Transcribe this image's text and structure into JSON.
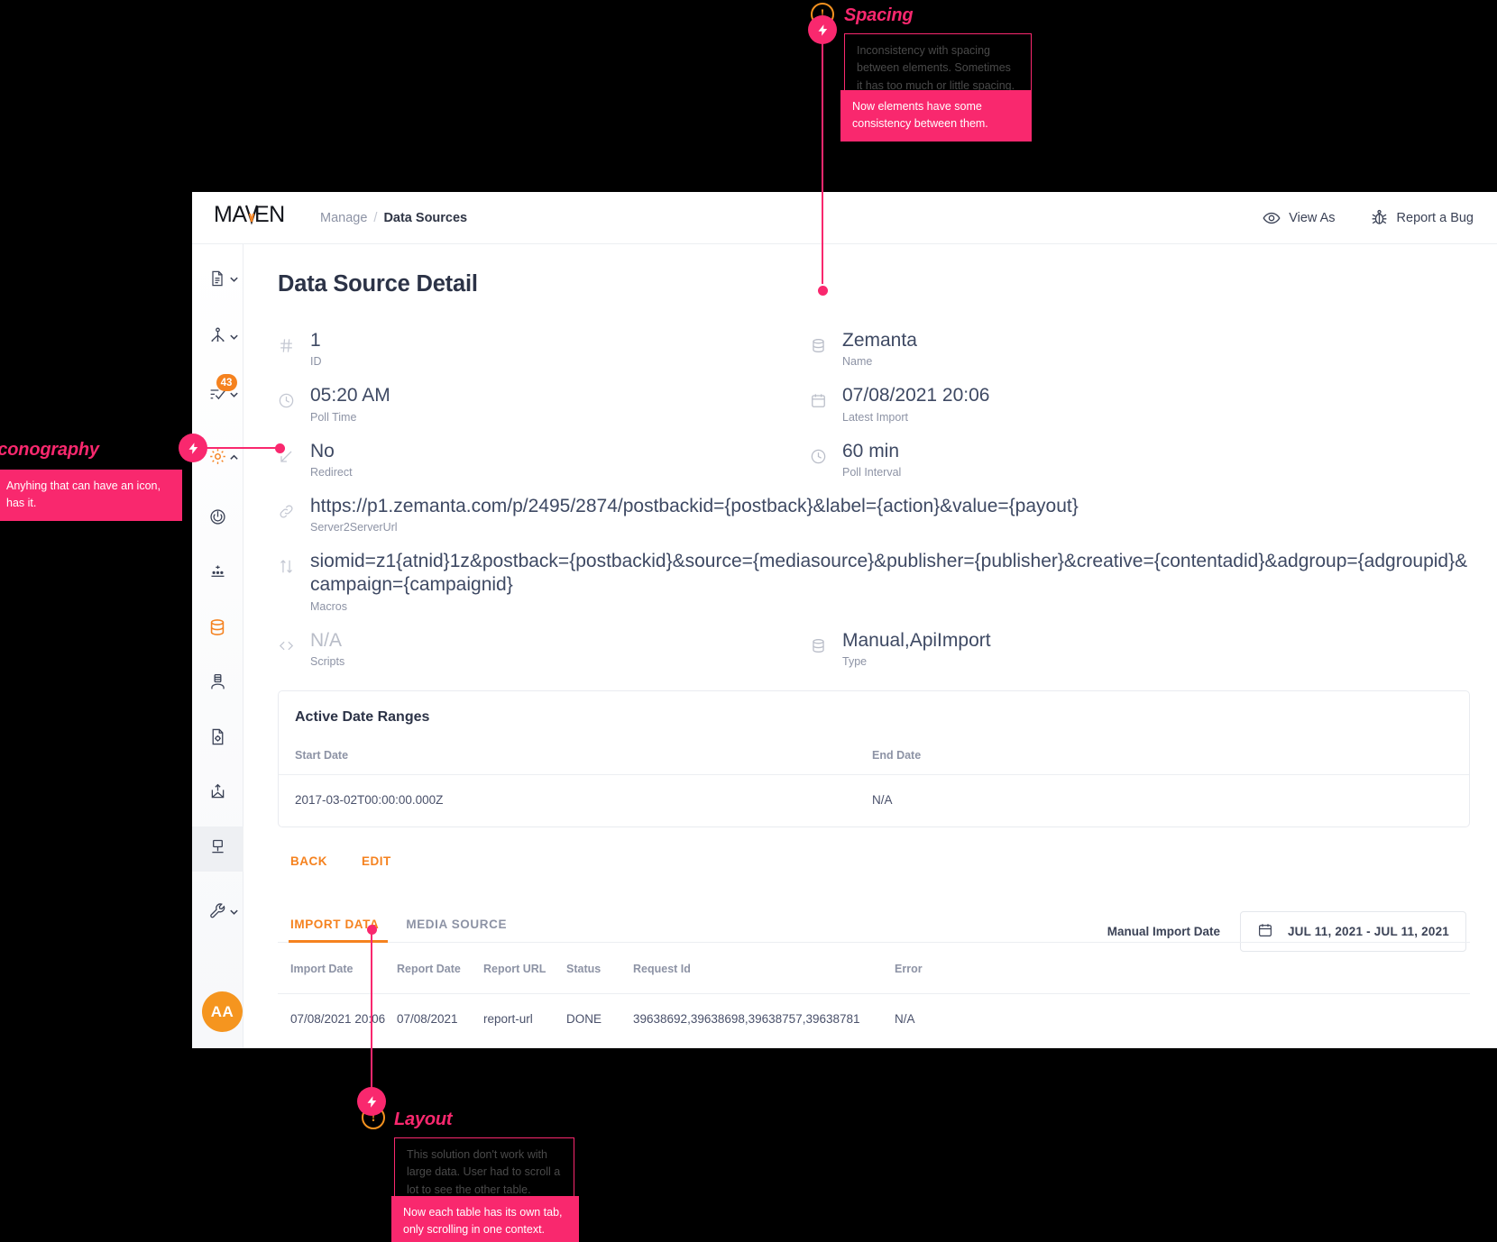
{
  "app": {
    "logo": "MAVEN",
    "breadcrumb": {
      "parent": "Manage",
      "separator": "/",
      "current": "Data Sources"
    },
    "header_actions": [
      {
        "id": "view-as",
        "label": "View As",
        "icon": "eye-icon"
      },
      {
        "id": "report-a-bug",
        "label": "Report a Bug",
        "icon": "bug-icon"
      }
    ]
  },
  "sidebar": {
    "items": [
      {
        "id": "documents",
        "icon": "document-icon",
        "chevron": "down",
        "badge": null
      },
      {
        "id": "network",
        "icon": "network-share-icon",
        "chevron": "down",
        "badge": null
      },
      {
        "id": "tasks",
        "icon": "checklist-icon",
        "chevron": "down",
        "badge": "43"
      },
      {
        "id": "settings",
        "icon": "gear-icon",
        "chevron": "up",
        "badge": null,
        "active": true
      },
      {
        "id": "power",
        "icon": "power-target-icon",
        "chevron": null,
        "badge": null
      },
      {
        "id": "analytics",
        "icon": "scatter-plot-icon",
        "chevron": null,
        "badge": null
      },
      {
        "id": "data-sources",
        "icon": "database-icon",
        "chevron": null,
        "badge": null,
        "selected": true
      },
      {
        "id": "users",
        "icon": "user-server-icon",
        "chevron": null,
        "badge": null
      },
      {
        "id": "reports",
        "icon": "document-gear-icon",
        "chevron": null,
        "badge": null
      },
      {
        "id": "uploads",
        "icon": "upload-envelope-icon",
        "chevron": null,
        "badge": null
      },
      {
        "id": "deploy",
        "icon": "sitemap-icon",
        "chevron": null,
        "badge": null,
        "highlight": true
      },
      {
        "id": "tools",
        "icon": "wrench-icon",
        "chevron": "down",
        "badge": null
      }
    ],
    "avatar": "AA"
  },
  "page": {
    "title": "Data Source Detail",
    "fields": [
      {
        "icon": "hash-icon",
        "value": "1",
        "label": "ID",
        "dim": false,
        "col": "left"
      },
      {
        "icon": "database-icon",
        "value": "Zemanta",
        "label": "Name",
        "dim": false,
        "col": "right"
      },
      {
        "icon": "clock-icon",
        "value": "05:20 AM",
        "label": "Poll Time",
        "dim": false,
        "col": "left"
      },
      {
        "icon": "calendar-icon",
        "value": "07/08/2021 20:06",
        "label": "Latest Import",
        "dim": false,
        "col": "right"
      },
      {
        "icon": "redirect-icon",
        "value": "No",
        "label": "Redirect",
        "dim": false,
        "col": "left"
      },
      {
        "icon": "clock-icon",
        "value": "60 min",
        "label": "Poll Interval",
        "dim": false,
        "col": "right"
      }
    ],
    "wide_fields": [
      {
        "icon": "link-icon",
        "value": "https://p1.zemanta.com/p/2495/2874/postbackid={postback}&label={action}&value={payout}",
        "label": "Server2ServerUrl"
      },
      {
        "icon": "exchange-icon",
        "value": "siomid=z1{atnid}1z&postback={postbackid}&source={mediasource}&publisher={publisher}&creative={contentadid}&adgroup={adgroupid}&campaign={campaignid}",
        "label": "Macros"
      }
    ],
    "bottom_fields": [
      {
        "icon": "code-icon",
        "value": "N/A",
        "label": "Scripts",
        "dim": true,
        "col": "left"
      },
      {
        "icon": "database-icon",
        "value": "Manual,ApiImport",
        "label": "Type",
        "dim": false,
        "col": "right"
      }
    ],
    "date_ranges_card": {
      "title": "Active Date Ranges",
      "columns": [
        "Start Date",
        "End Date"
      ],
      "rows": [
        [
          "2017-03-02T00:00:00.000Z",
          "N/A"
        ]
      ]
    },
    "buttons": [
      {
        "id": "back",
        "label": "BACK"
      },
      {
        "id": "edit",
        "label": "EDIT"
      }
    ],
    "manual_import": {
      "label": "Manual Import Date",
      "icon": "calendar-icon",
      "value": "JUL 11, 2021 - JUL 11, 2021"
    },
    "tabs": [
      {
        "id": "import-data",
        "label": "IMPORT DATA",
        "selected": true
      },
      {
        "id": "media-source",
        "label": "MEDIA SOURCE",
        "selected": false
      }
    ],
    "import_table": {
      "columns": [
        "Import Date",
        "Report Date",
        "Report URL",
        "Status",
        "Request Id",
        "Error"
      ],
      "rows": [
        [
          "07/08/2021 20:06",
          "07/08/2021",
          "report-url",
          "DONE",
          "39638692,39638698,39638757,39638781",
          "N/A"
        ]
      ]
    }
  },
  "annotations": [
    {
      "id": "spacing",
      "title": "Spacing",
      "old_text": "Inconsistency with spacing between elements. Sometimes it has too much or little spacing.",
      "new_text": "Now elements have some consistency between them."
    },
    {
      "id": "iconography",
      "title": "Iconography",
      "new_text": "Anyhing that can have an icon, has it."
    },
    {
      "id": "layout",
      "title": "Layout",
      "old_text": "This solution don't work with large data. User had to scroll a lot to see the other table.",
      "new_text": "Now each table has its own tab, only scrolling in one context."
    }
  ],
  "colors": {
    "accent_orange": "#f5821f",
    "annotation_pink": "#f9286e",
    "warning_orange": "#f5921f",
    "text_dark": "#2c3347",
    "text_muted": "#8d93a5"
  }
}
